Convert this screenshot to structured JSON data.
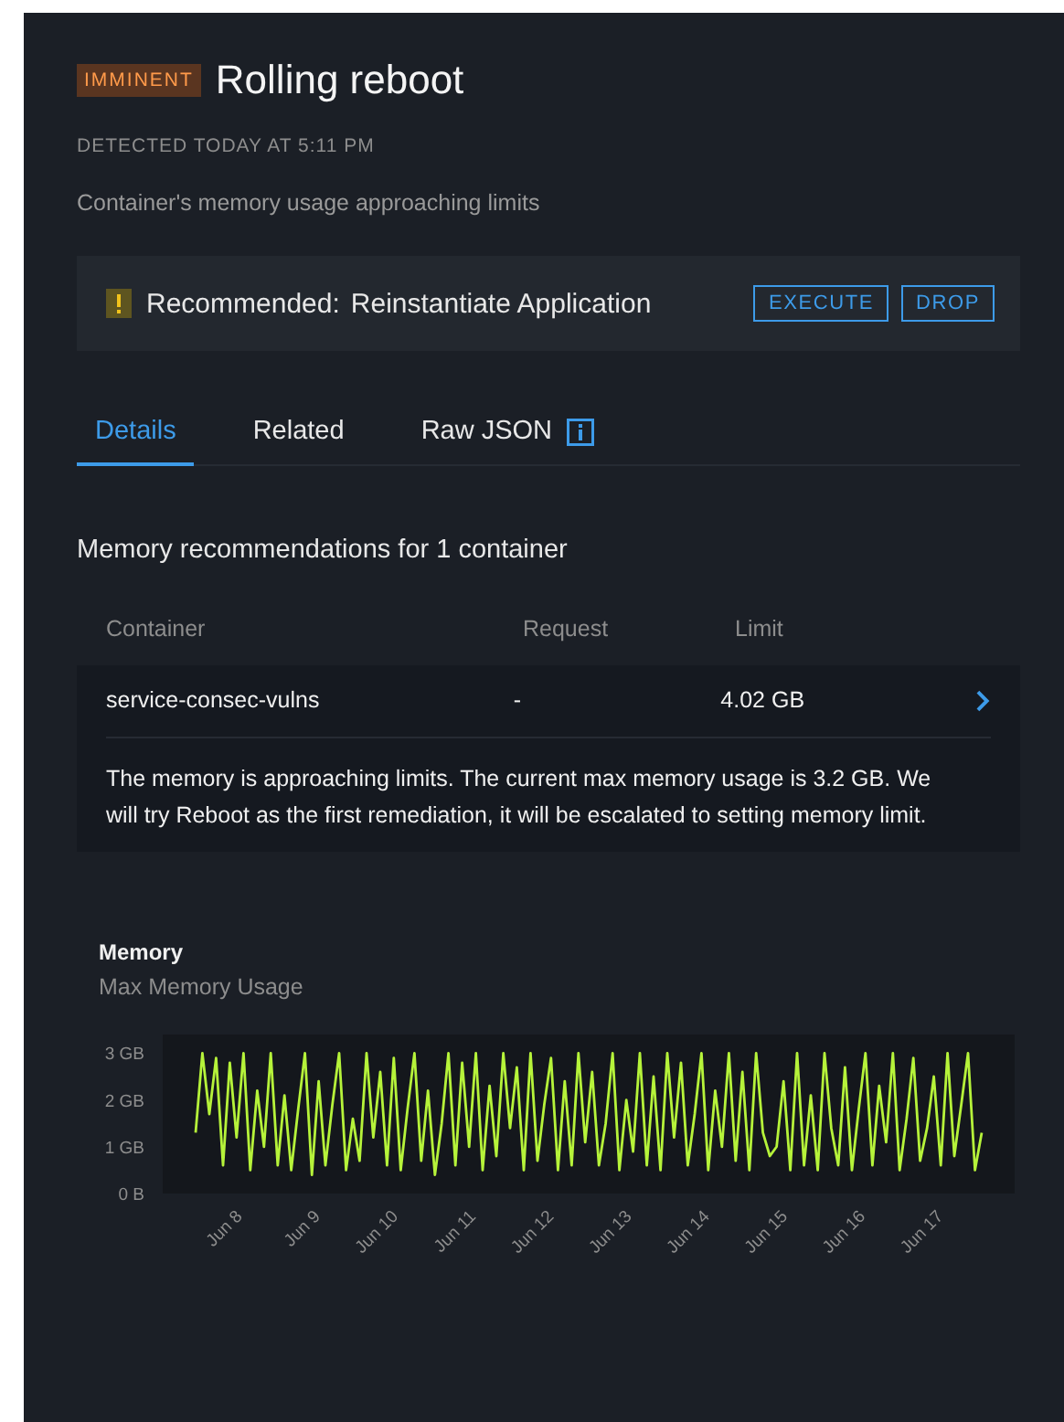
{
  "alert": {
    "severity": "IMMINENT",
    "title": "Rolling reboot",
    "detected": "DETECTED TODAY AT 5:11 PM",
    "description": "Container's memory usage approaching limits"
  },
  "recommendation": {
    "label": "Recommended:",
    "action": "Reinstantiate Application",
    "buttons": [
      "EXECUTE",
      "DROP"
    ]
  },
  "tabs": [
    {
      "label": "Details",
      "selected": true,
      "info": false
    },
    {
      "label": "Related",
      "selected": false,
      "info": false
    },
    {
      "label": "Raw JSON",
      "selected": false,
      "info": true
    }
  ],
  "section_title": "Memory recommendations for 1 container",
  "table": {
    "columns": [
      "Container",
      "Request",
      "Limit"
    ],
    "rows": [
      {
        "cells": [
          "service-consec-vulns",
          "-",
          "4.02 GB"
        ],
        "detail": "The memory is approaching limits. The current max memory usage is 3.2 GB. We will try Reboot as the first remediation, it will be escalated to setting memory limit."
      }
    ]
  },
  "chart": {
    "title": "Memory",
    "x_labels": [
      "Jun 8",
      "Jun 9",
      "Jun 10",
      "Jun 11",
      "Jun 12",
      "Jun 13",
      "Jun 14",
      "Jun 15",
      "Jun 16",
      "Jun 17"
    ],
    "chart_data": {
      "type": "line",
      "ylim": [
        0,
        3.4
      ],
      "yticks": [
        {
          "value": 3,
          "label": "3 GB"
        },
        {
          "value": 2,
          "label": "2 GB"
        },
        {
          "value": 1,
          "label": "1 GB"
        },
        {
          "value": 0,
          "label": "0 B"
        }
      ],
      "series": [
        {
          "name": "Max Memory Usage",
          "color": "#b6f33a",
          "values": [
            1.3,
            3.0,
            1.7,
            2.9,
            0.6,
            2.8,
            1.2,
            3.0,
            0.5,
            2.2,
            1.0,
            3.0,
            0.6,
            2.1,
            0.5,
            1.8,
            3.0,
            0.4,
            2.4,
            0.6,
            1.9,
            3.0,
            0.5,
            1.6,
            0.7,
            3.0,
            1.2,
            2.6,
            0.6,
            2.9,
            0.5,
            1.8,
            3.0,
            0.7,
            2.2,
            0.4,
            1.5,
            3.0,
            0.6,
            2.8,
            1.0,
            3.0,
            0.5,
            2.3,
            0.8,
            3.0,
            1.4,
            2.7,
            0.5,
            3.0,
            0.7,
            1.9,
            2.9,
            0.5,
            2.4,
            0.6,
            3.0,
            1.1,
            2.6,
            0.6,
            1.5,
            3.0,
            0.5,
            2.0,
            0.9,
            3.0,
            0.6,
            2.5,
            0.5,
            3.0,
            1.2,
            2.8,
            0.6,
            1.7,
            3.0,
            0.5,
            2.2,
            1.0,
            3.0,
            0.7,
            2.6,
            0.5,
            3.0,
            1.3,
            0.8,
            1.0,
            2.4,
            0.5,
            3.0,
            0.6,
            2.1,
            0.5,
            3.0,
            1.4,
            0.6,
            2.7,
            0.5,
            1.8,
            3.0,
            0.6,
            2.3,
            1.1,
            3.0,
            0.5,
            1.6,
            2.9,
            0.7,
            1.4,
            2.5,
            0.6,
            3.0,
            0.8,
            1.9,
            3.0,
            0.5,
            1.3
          ]
        }
      ]
    }
  }
}
